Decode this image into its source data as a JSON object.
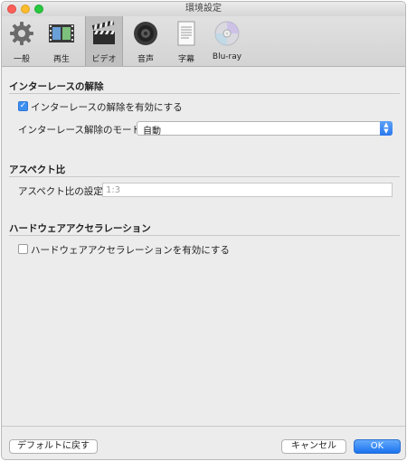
{
  "window": {
    "title": "環境設定"
  },
  "toolbar": {
    "items": [
      {
        "label": "一般",
        "icon": "gear-icon"
      },
      {
        "label": "再生",
        "icon": "film-frames-icon"
      },
      {
        "label": "ビデオ",
        "icon": "clapperboard-icon",
        "selected": true
      },
      {
        "label": "音声",
        "icon": "speaker-icon"
      },
      {
        "label": "字幕",
        "icon": "subtitle-document-icon"
      },
      {
        "label": "Blu-ray",
        "icon": "disc-icon"
      }
    ]
  },
  "deinterlace": {
    "title": "インターレースの解除",
    "enable_label": "インターレースの解除を有効にする",
    "enable_checked": true,
    "mode_label": "インターレース解除のモード:",
    "mode_value": "自動"
  },
  "aspect": {
    "title": "アスペクト比",
    "setting_label": "アスペクト比の設定:",
    "setting_placeholder": "1:3"
  },
  "hardware": {
    "title": "ハードウェアアクセラレーション",
    "enable_label": "ハードウェアアクセラレーションを有効にする",
    "enable_checked": false
  },
  "footer": {
    "defaults_button": "デフォルトに戻す",
    "cancel_button": "キャンセル",
    "ok_button": "OK"
  },
  "colors": {
    "accent": "#2a78ee",
    "close": "#fc5f57",
    "minimize": "#fdbc2e",
    "maximize": "#28c840"
  }
}
